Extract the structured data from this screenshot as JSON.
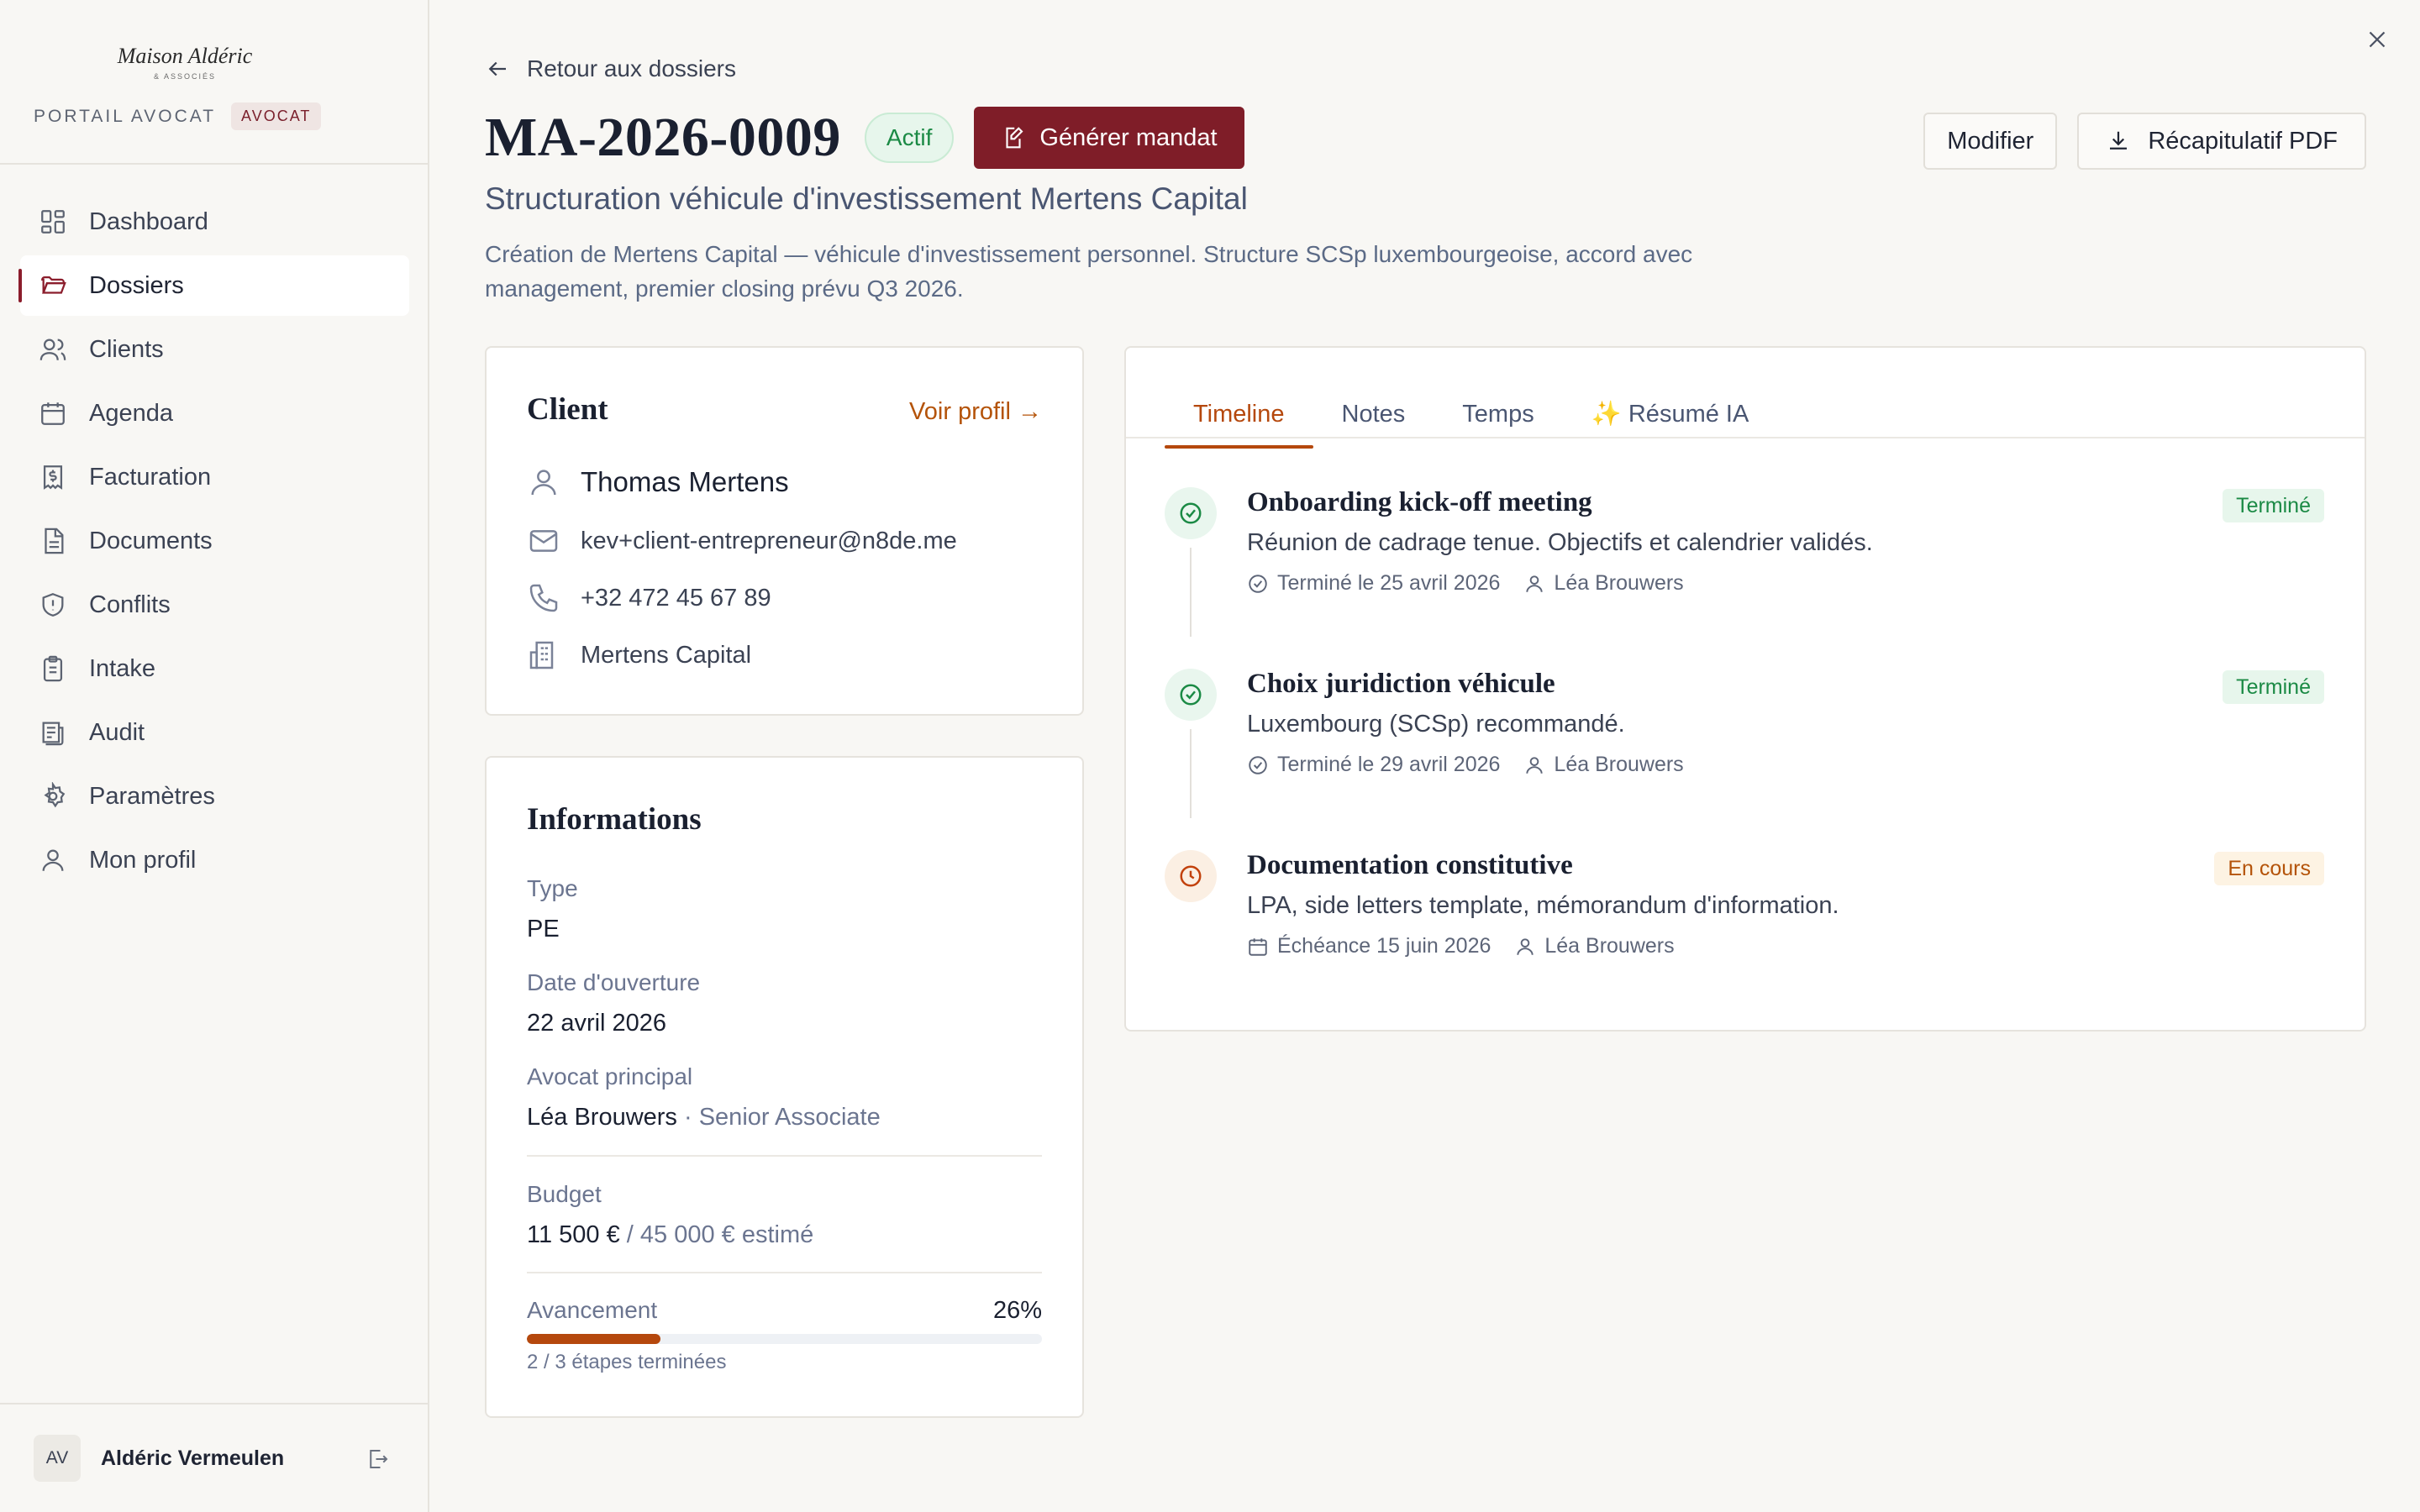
{
  "brand": {
    "logo": "Maison Aldéric",
    "sub": "& ASSOCIÉS",
    "portal": "PORTAIL AVOCAT",
    "role": "AVOCAT"
  },
  "nav": [
    {
      "label": "Dashboard",
      "icon": "dashboard-icon"
    },
    {
      "label": "Dossiers",
      "icon": "folder-icon"
    },
    {
      "label": "Clients",
      "icon": "users-icon"
    },
    {
      "label": "Agenda",
      "icon": "calendar-icon"
    },
    {
      "label": "Facturation",
      "icon": "invoice-icon"
    },
    {
      "label": "Documents",
      "icon": "document-icon"
    },
    {
      "label": "Conflits",
      "icon": "shield-icon"
    },
    {
      "label": "Intake",
      "icon": "clipboard-icon"
    },
    {
      "label": "Audit",
      "icon": "audit-log-icon"
    },
    {
      "label": "Paramètres",
      "icon": "gear-icon"
    },
    {
      "label": "Mon profil",
      "icon": "user-icon"
    }
  ],
  "user": {
    "initials": "AV",
    "name": "Aldéric Vermeulen"
  },
  "header": {
    "back": "Retour aux dossiers",
    "case_id": "MA-2026-0009",
    "status": "Actif",
    "generate": "Générer mandat",
    "edit": "Modifier",
    "pdf": "Récapitulatif PDF",
    "subtitle": "Structuration véhicule d'investissement Mertens Capital",
    "description": "Création de Mertens Capital — véhicule d'investissement personnel. Structure SCSp luxembourgeoise, accord avec management, premier closing prévu Q3 2026."
  },
  "client": {
    "heading": "Client",
    "profile_link": "Voir profil →",
    "name": "Thomas Mertens",
    "email": "kev+client-entrepreneur@n8de.me",
    "phone": "+32 472 45 67 89",
    "company": "Mertens Capital"
  },
  "info": {
    "heading": "Informations",
    "type_label": "Type",
    "type_value": "PE",
    "date_label": "Date d'ouverture",
    "date_value": "22 avril 2026",
    "lawyer_label": "Avocat principal",
    "lawyer_name": "Léa Brouwers",
    "lawyer_role": "· Senior Associate",
    "budget_label": "Budget",
    "budget_spent": "11 500 €",
    "budget_estimate": "/ 45 000 € estimé",
    "progress_label": "Avancement",
    "progress_pct": "26%",
    "progress_value": 0.26,
    "progress_note": "2 / 3 étapes terminées"
  },
  "tabs": [
    {
      "label": "Timeline",
      "active": true
    },
    {
      "label": "Notes"
    },
    {
      "label": "Temps"
    },
    {
      "label": "✨ Résumé IA"
    }
  ],
  "timeline": [
    {
      "title": "Onboarding kick-off meeting",
      "desc": "Réunion de cadrage tenue. Objectifs et calendrier validés.",
      "date": "Terminé le 25 avril 2026",
      "owner": "Léa Brouwers",
      "badge": "Terminé",
      "state": "done"
    },
    {
      "title": "Choix juridiction véhicule",
      "desc": "Luxembourg (SCSp) recommandé.",
      "date": "Terminé le 29 avril 2026",
      "owner": "Léa Brouwers",
      "badge": "Terminé",
      "state": "done"
    },
    {
      "title": "Documentation constitutive",
      "desc": "LPA, side letters template, mémorandum d'information.",
      "date": "Échéance 15 juin 2026",
      "owner": "Léa Brouwers",
      "badge": "En cours",
      "state": "progress"
    }
  ],
  "colors": {
    "brand": "#7f1d28",
    "accent": "#b5480d",
    "success": "#1b8a45"
  }
}
